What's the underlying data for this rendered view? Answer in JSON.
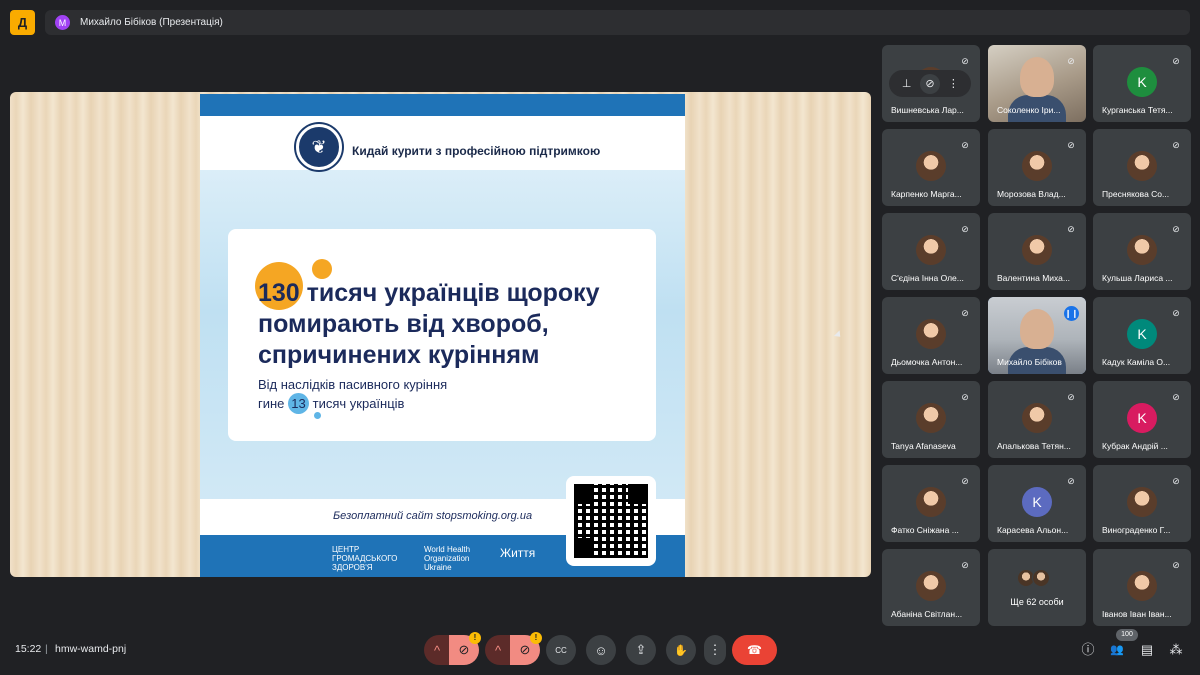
{
  "app": {
    "logo_glyph": "Д"
  },
  "presenter_bar": {
    "avatar_letter": "M",
    "title": "Михайло Бібіков (Презентація)"
  },
  "slide": {
    "tagline": "Кидай курити з професійною підтримкою",
    "headline_number": "130",
    "headline_rest": " тисяч українців щороку",
    "headline_line2": "помирають від хвороб,",
    "headline_line3": "спричинених курінням",
    "sub_line1": "Від наслідків пасивного куріння",
    "sub_line2_pre": "гине ",
    "sub_line2_num": "13",
    "sub_line2_post": " тисяч українців",
    "site": "Безоплатний сайт stopsmoking.org.ua",
    "footer_logo1": "ЦЕНТР ГРОМАДСЬКОГО ЗДОРОВ'Я",
    "footer_logo2": "World Health Organization Ukraine",
    "footer_logo3": "Життя"
  },
  "pin_bar": {
    "pin_icon": "pin-icon",
    "mute_icon": "mic-off-icon",
    "more_icon": "more-vert-icon"
  },
  "participants": [
    {
      "name": "Вишневська Лар...",
      "type": "avatar-photo"
    },
    {
      "name": "Соколенко Іри...",
      "type": "video"
    },
    {
      "name": "Курганська Тетя...",
      "type": "letter",
      "letter": "K",
      "color": "#1e8e3e"
    },
    {
      "name": "Карпенко Марга...",
      "type": "avatar-photo"
    },
    {
      "name": "Морозова Влад...",
      "type": "avatar-photo"
    },
    {
      "name": "Преснякова Со...",
      "type": "avatar-photo"
    },
    {
      "name": "С'єдіна Інна Оле...",
      "type": "avatar-photo"
    },
    {
      "name": "Валентина Миха...",
      "type": "avatar-photo"
    },
    {
      "name": "Кульша Лариса ...",
      "type": "avatar-photo"
    },
    {
      "name": "Дьомочка Антон...",
      "type": "avatar-photo"
    },
    {
      "name": "Михайло Бібіков",
      "type": "presenter-video"
    },
    {
      "name": "Кадук Каміла О...",
      "type": "letter",
      "letter": "K",
      "color": "#00897b"
    },
    {
      "name": "Tanya Afanaseva",
      "type": "avatar-photo"
    },
    {
      "name": "Апалькова Тетян...",
      "type": "avatar-photo"
    },
    {
      "name": "Кубрак Андрій ...",
      "type": "letter",
      "letter": "K",
      "color": "#d81b60"
    },
    {
      "name": "Фатко Сніжана ...",
      "type": "avatar-photo"
    },
    {
      "name": "Карасева Альон...",
      "type": "letter",
      "letter": "K",
      "color": "#5c6bc0"
    },
    {
      "name": "Винограденко Г...",
      "type": "avatar-photo"
    },
    {
      "name": "Абаніна Світлан...",
      "type": "avatar-photo"
    },
    {
      "name": "",
      "type": "more",
      "label": "Ще 62 особи"
    },
    {
      "name": "Іванов Іван Іван...",
      "type": "avatar-photo"
    }
  ],
  "bottom": {
    "time": "15:22",
    "separator": "|",
    "meeting_code": "hmw-wamd-pnj",
    "warn_mark": "!",
    "participants_count": "100"
  },
  "icons": {
    "chevron": "^",
    "mic_off": "🎙",
    "cam_off": "⊘",
    "captions": "CC",
    "emoji": "☺",
    "present": "⇪",
    "hand": "✋",
    "more": "⋮",
    "hangup": "☎",
    "info": "ⓘ",
    "people": "👥",
    "chat": "▤",
    "activities": "⁂"
  },
  "colors": {
    "hangup": "#ea4335",
    "mic_off_bg": "#f28b82",
    "accent": "#8ab4f8",
    "warning": "#fbbc04"
  }
}
